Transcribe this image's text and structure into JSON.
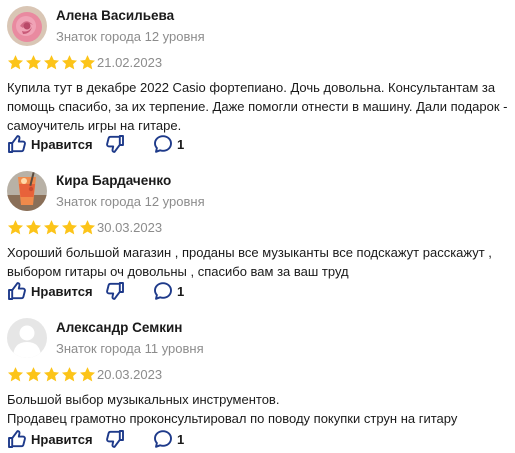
{
  "colors": {
    "star": "#fcc419",
    "icon": "#1e3a8a",
    "muted": "#8c8c8c",
    "text": "#1a1a1a"
  },
  "reviews": [
    {
      "author": "Алена Васильева",
      "level": "Знаток города 12 уровня",
      "avatar": "rose-photo-avatar",
      "rating": 5,
      "date": "21.02.2023",
      "text": "Купила тут в декабре 2022 Casio фортепиано. Дочь довольна. Консультантам за помощь спасибо, за их терпение. Даже помогли отнести в машину. Дали подарок - самоучитель игры на гитаре.",
      "like_label": "Нравится",
      "comments": "1"
    },
    {
      "author": "Кира Бардаченко",
      "level": "Знаток города 12 уровня",
      "avatar": "drink-photo-avatar",
      "rating": 5,
      "date": "30.03.2023",
      "text": "Хороший большой магазин , проданы все музыканты все подскажут расскажут , выбором гитары оч довольны , спасибо вам за ваш труд",
      "like_label": "Нравится",
      "comments": "1"
    },
    {
      "author": "Александр Семкин",
      "level": "Знаток города 11 уровня",
      "avatar": "default-user-avatar",
      "rating": 5,
      "date": "20.03.2023",
      "text": "Большой выбор музыкальных инструментов.\nПродавец грамотно проконсультировал по поводу покупки струн на гитару",
      "like_label": "Нравится",
      "comments": "1"
    }
  ]
}
